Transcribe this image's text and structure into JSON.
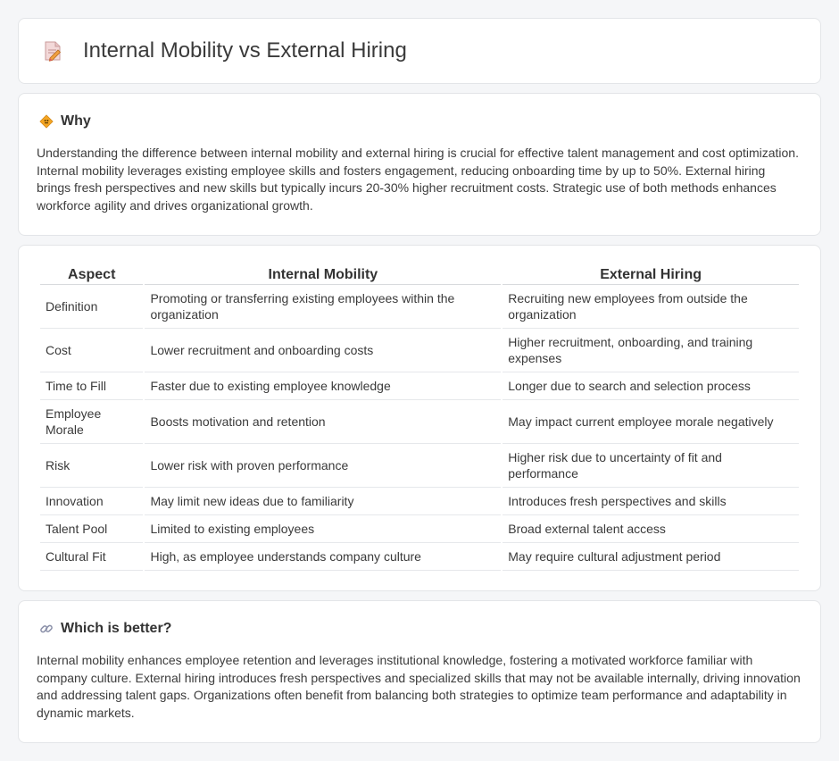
{
  "header": {
    "title": "Internal Mobility vs External Hiring",
    "icon": "document-pen-icon"
  },
  "why": {
    "heading": "Why",
    "icon": "diamond-sign-icon",
    "text": "Understanding the difference between internal mobility and external hiring is crucial for effective talent management and cost optimization. Internal mobility leverages existing employee skills and fosters engagement, reducing onboarding time by up to 50%. External hiring brings fresh perspectives and new skills but typically incurs 20-30% higher recruitment costs. Strategic use of both methods enhances workforce agility and drives organizational growth."
  },
  "table": {
    "headers": [
      "Aspect",
      "Internal Mobility",
      "External Hiring"
    ],
    "rows": [
      [
        "Definition",
        "Promoting or transferring existing employees within the organization",
        "Recruiting new employees from outside the organization"
      ],
      [
        "Cost",
        "Lower recruitment and onboarding costs",
        "Higher recruitment, onboarding, and training expenses"
      ],
      [
        "Time to Fill",
        "Faster due to existing employee knowledge",
        "Longer due to search and selection process"
      ],
      [
        "Employee Morale",
        "Boosts motivation and retention",
        "May impact current employee morale negatively"
      ],
      [
        "Risk",
        "Lower risk with proven performance",
        "Higher risk due to uncertainty of fit and performance"
      ],
      [
        "Innovation",
        "May limit new ideas due to familiarity",
        "Introduces fresh perspectives and skills"
      ],
      [
        "Talent Pool",
        "Limited to existing employees",
        "Broad external talent access"
      ],
      [
        "Cultural Fit",
        "High, as employee understands company culture",
        "May require cultural adjustment period"
      ]
    ]
  },
  "better": {
    "heading": "Which is better?",
    "icon": "link-icon",
    "text": "Internal mobility enhances employee retention and leverages institutional knowledge, fostering a motivated workforce familiar with company culture. External hiring introduces fresh perspectives and specialized skills that may not be available internally, driving innovation and addressing talent gaps. Organizations often benefit from balancing both strategies to optimize team performance and adaptability in dynamic markets."
  }
}
